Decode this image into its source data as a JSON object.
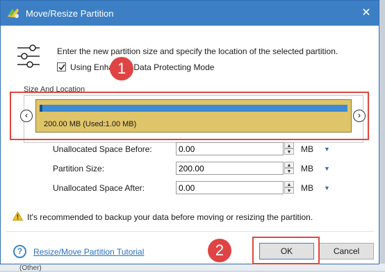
{
  "window": {
    "title": "Move/Resize Partition",
    "close_symbol": "✕"
  },
  "header": {
    "description": "Enter the new partition size and specify the location of the selected partition.",
    "checkbox_label": "Using Enhanced Data Protecting Mode",
    "checkbox_checked": true
  },
  "annotations": {
    "badge1": "1",
    "badge2": "2",
    "color": "#e2453b"
  },
  "size_location": {
    "group_label": "Size And Location",
    "left_arrow": "‹",
    "right_arrow": "›",
    "partition_label": "200.00 MB (Used:1.00 MB)",
    "partition_color": "#dfc469",
    "bar_color": "#3c8bd3"
  },
  "fields": [
    {
      "label": "Unallocated Space Before:",
      "value": "0.00",
      "unit": "MB"
    },
    {
      "label": "Partition Size:",
      "value": "200.00",
      "unit": "MB"
    },
    {
      "label": "Unallocated Space After:",
      "value": "0.00",
      "unit": "MB"
    }
  ],
  "warning": {
    "text": "It's recommended to backup your data before moving or resizing the partition."
  },
  "footer": {
    "help_symbol": "?",
    "tutorial_link": "Resize/Move Partition Tutorial",
    "ok_label": "OK",
    "cancel_label": "Cancel"
  },
  "background": {
    "other_label": "(Other)"
  }
}
